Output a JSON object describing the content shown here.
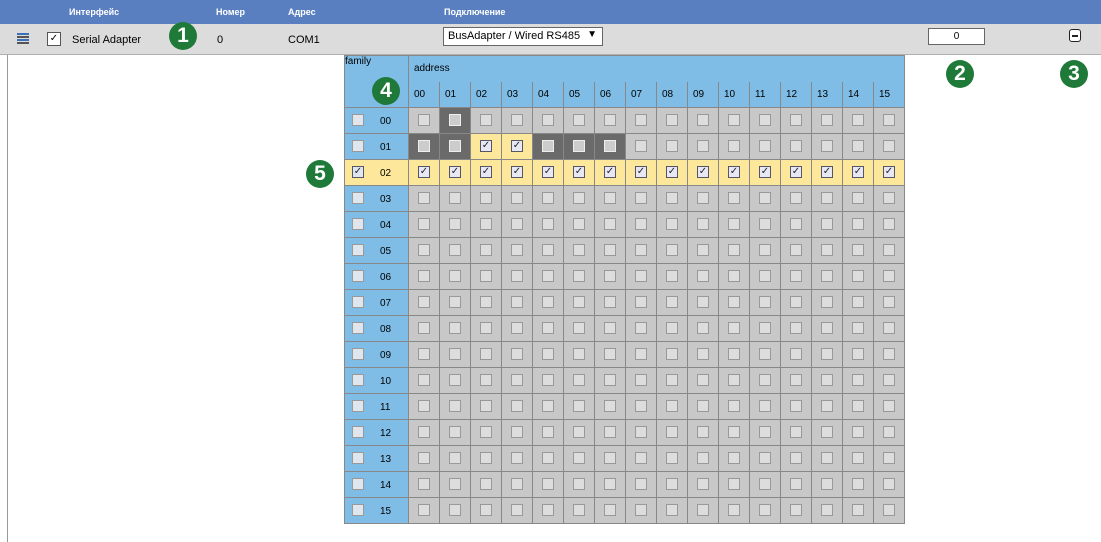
{
  "header": {
    "col_interface": "Интерфейс",
    "col_number": "Номер",
    "col_address": "Адрес",
    "col_connection": "Подключение"
  },
  "row": {
    "icon": "list-icon",
    "enabled": true,
    "interface_name": "Serial Adapter",
    "number": "0",
    "address": "COM1",
    "connection": "BusAdapter / Wired RS485",
    "value": "0",
    "remove_icon": "minus-box-icon"
  },
  "badges": [
    "1",
    "2",
    "3",
    "4",
    "5"
  ],
  "grid": {
    "family_label": "family",
    "address_label": "address",
    "addresses": [
      "00",
      "01",
      "02",
      "03",
      "04",
      "05",
      "06",
      "07",
      "08",
      "09",
      "10",
      "11",
      "12",
      "13",
      "14",
      "15"
    ],
    "families": [
      "00",
      "01",
      "02",
      "03",
      "04",
      "05",
      "06",
      "07",
      "08",
      "09",
      "10",
      "11",
      "12",
      "13",
      "14",
      "15"
    ],
    "checked_families": [
      "02"
    ],
    "checked_cells": [
      [
        1,
        2
      ],
      [
        1,
        3
      ],
      [
        2,
        0
      ],
      [
        2,
        1
      ],
      [
        2,
        2
      ],
      [
        2,
        3
      ],
      [
        2,
        4
      ],
      [
        2,
        5
      ],
      [
        2,
        6
      ],
      [
        2,
        7
      ],
      [
        2,
        8
      ],
      [
        2,
        9
      ],
      [
        2,
        10
      ],
      [
        2,
        11
      ],
      [
        2,
        12
      ],
      [
        2,
        13
      ],
      [
        2,
        14
      ],
      [
        2,
        15
      ]
    ],
    "dark_cells": [
      [
        0,
        1
      ],
      [
        1,
        0
      ],
      [
        1,
        1
      ],
      [
        1,
        4
      ],
      [
        1,
        5
      ],
      [
        1,
        6
      ]
    ],
    "highlight_cells": [
      [
        1,
        2
      ],
      [
        1,
        3
      ],
      [
        2,
        0
      ],
      [
        2,
        1
      ],
      [
        2,
        2
      ],
      [
        2,
        3
      ],
      [
        2,
        4
      ],
      [
        2,
        5
      ],
      [
        2,
        6
      ],
      [
        2,
        7
      ],
      [
        2,
        8
      ],
      [
        2,
        9
      ],
      [
        2,
        10
      ],
      [
        2,
        11
      ],
      [
        2,
        12
      ],
      [
        2,
        13
      ],
      [
        2,
        14
      ],
      [
        2,
        15
      ]
    ],
    "highlight_families": [
      "02"
    ],
    "colors": {
      "header": "#5a7fc0",
      "family_bg": "#7fbde6",
      "cell_bg": "#c8c8c8",
      "dark": "#6a6a6a",
      "highlight": "#fde79b",
      "badge": "#1f7a3a"
    }
  }
}
